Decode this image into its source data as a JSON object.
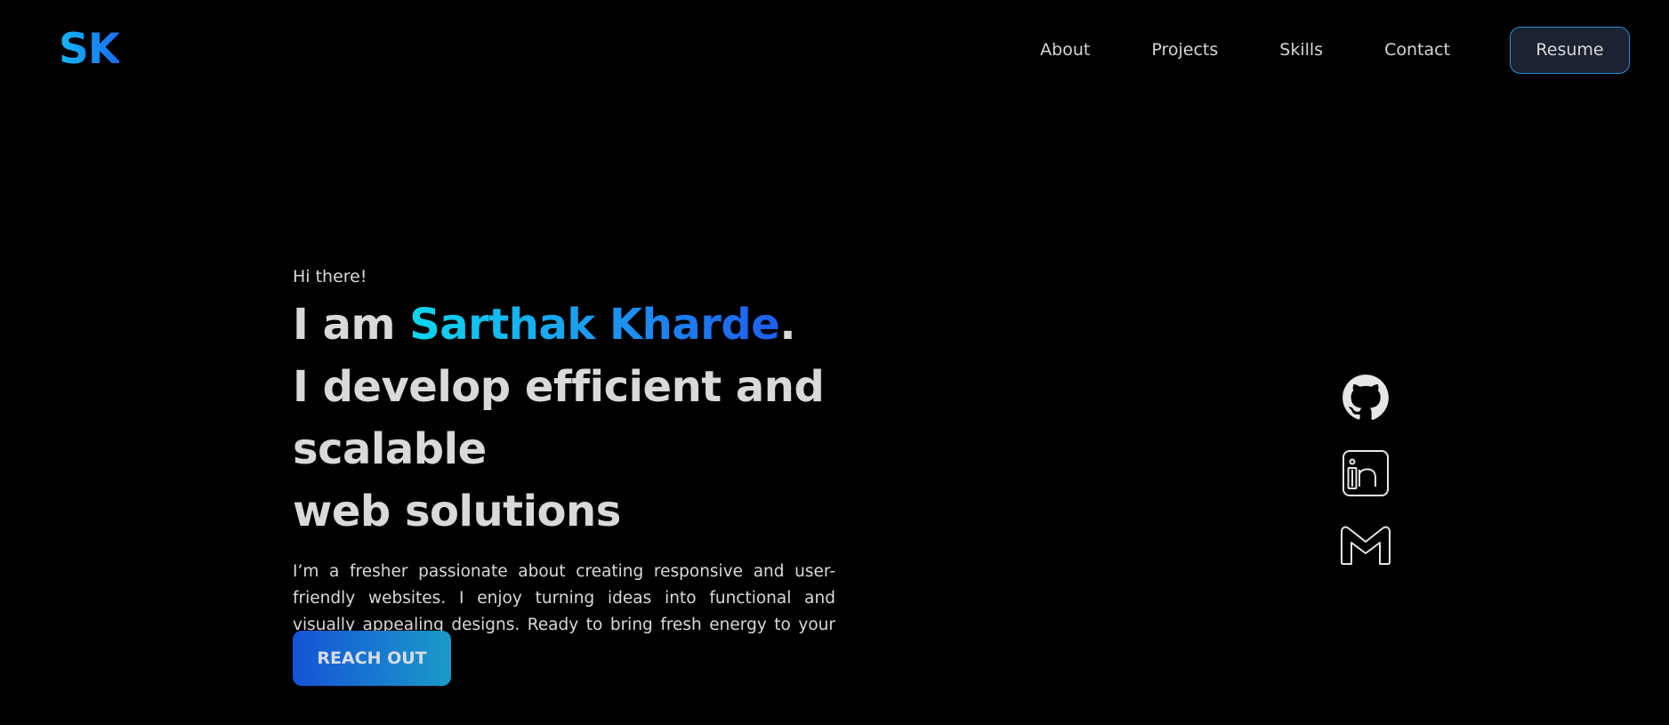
{
  "header": {
    "logo": "SK",
    "nav": [
      {
        "label": "About"
      },
      {
        "label": "Projects"
      },
      {
        "label": "Skills"
      },
      {
        "label": "Contact"
      }
    ],
    "resume_label": "Resume"
  },
  "hero": {
    "greeting": "Hi there!",
    "intro_prefix": "I am ",
    "name": "Sarthak Kharde",
    "intro_suffix": ".",
    "tagline_line1": "I develop efficient and scalable",
    "tagline_line2": "web solutions",
    "description": "I’m a fresher passionate about creating responsive and user-friendly websites. I enjoy turning ideas into functional and visually appealing designs. Ready to bring fresh energy to your web projects!",
    "cta_label": "REACH OUT"
  },
  "socials": [
    {
      "icon": "github-icon"
    },
    {
      "icon": "linkedin-icon"
    },
    {
      "icon": "gmail-icon"
    }
  ],
  "colors": {
    "background": "#000000",
    "text": "#d9d9d9",
    "accent_cyan": "#0fd7ee",
    "accent_blue": "#1f5ef0",
    "resume_border": "#2f8fd8"
  }
}
